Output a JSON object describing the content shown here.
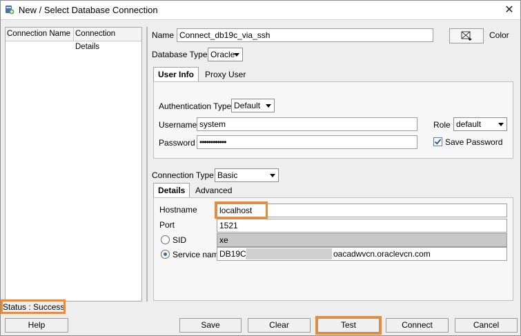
{
  "window": {
    "title": "New / Select Database Connection",
    "close_glyph": "✕"
  },
  "connection_list": {
    "columns": [
      "Connection Name",
      "Connection Details"
    ]
  },
  "form": {
    "name_label": "Name",
    "name_value": "Connect_db19c_via_ssh",
    "color_label": "Color",
    "database_type_label": "Database Type",
    "database_type_value": "Oracle",
    "tabs": [
      "User Info",
      "Proxy User"
    ],
    "auth_type_label": "Authentication Type",
    "auth_type_value": "Default",
    "username_label": "Username",
    "username_value": "system",
    "role_label": "Role",
    "role_value": "default",
    "password_label": "Password",
    "password_value": "••••••••••••",
    "save_password_label": "Save Password",
    "save_password_checked": true,
    "connection_type_label": "Connection Type",
    "connection_type_value": "Basic",
    "detail_tabs": [
      "Details",
      "Advanced"
    ],
    "hostname_label": "Hostname",
    "hostname_value": "localhost",
    "port_label": "Port",
    "port_value": "1521",
    "sid_label": "SID",
    "sid_value": "xe",
    "service_name_label": "Service name",
    "service_name_prefix": "DB19C_",
    "service_name_suffix": "oacadwvcn.oraclevcn.com"
  },
  "status": {
    "text": "Status : Success"
  },
  "buttons": {
    "help": "Help",
    "save": "Save",
    "clear": "Clear",
    "test": "Test",
    "connect": "Connect",
    "cancel": "Cancel"
  },
  "colors": {
    "highlight": "#f08a2c",
    "accent": "#3a68b8"
  }
}
